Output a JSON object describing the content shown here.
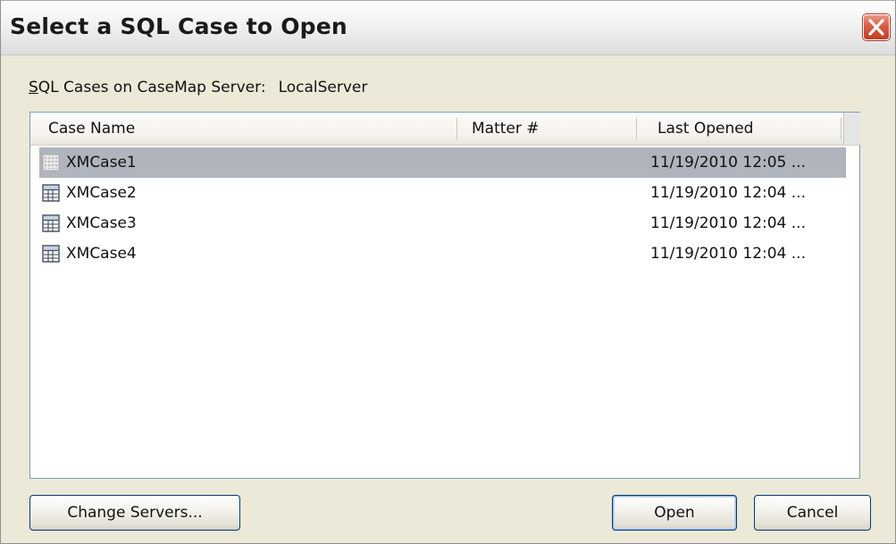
{
  "window": {
    "title": "Select a SQL Case to Open",
    "close_icon": "close-icon",
    "accent_close": "#d0503a"
  },
  "server": {
    "label_prefix_underlined": "S",
    "label_rest": "QL Cases on CaseMap Server:",
    "value": "LocalServer"
  },
  "list": {
    "columns": [
      "Case Name",
      "Matter #",
      "Last Opened"
    ],
    "rows": [
      {
        "name": "XMCase1",
        "matter": "",
        "last_opened": "11/19/2010 12:05 ...",
        "icon": "database-icon-disabled",
        "selected": true
      },
      {
        "name": "XMCase2",
        "matter": "",
        "last_opened": "11/19/2010 12:04 ...",
        "icon": "database-icon",
        "selected": false
      },
      {
        "name": "XMCase3",
        "matter": "",
        "last_opened": "11/19/2010 12:04 ...",
        "icon": "database-icon",
        "selected": false
      },
      {
        "name": "XMCase4",
        "matter": "",
        "last_opened": "11/19/2010 12:04 ...",
        "icon": "database-icon",
        "selected": false
      }
    ],
    "selected_color": "#b0b4bd"
  },
  "buttons": {
    "change_servers": "Change Servers...",
    "open": "Open",
    "cancel": "Cancel"
  }
}
